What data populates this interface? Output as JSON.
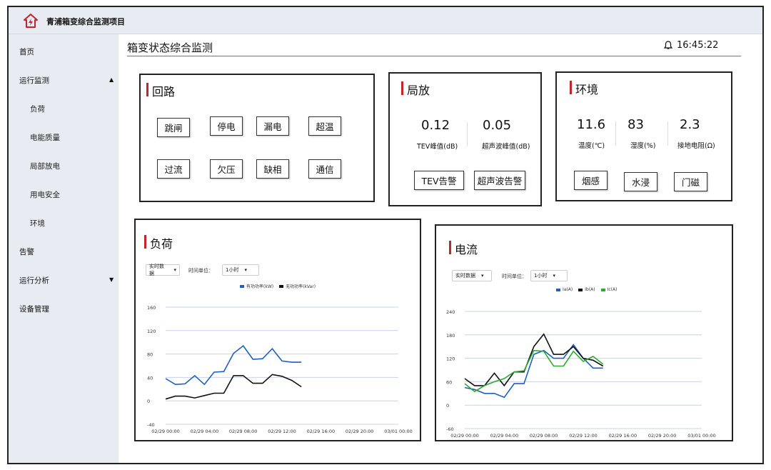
{
  "app": {
    "title": "青浦箱变综合监测项目"
  },
  "sidebar": {
    "items": [
      {
        "label": "首页"
      },
      {
        "label": "运行监测",
        "caret": "▲"
      },
      {
        "label": "负荷"
      },
      {
        "label": "电能质量"
      },
      {
        "label": "局部放电"
      },
      {
        "label": "用电安全"
      },
      {
        "label": "环境"
      },
      {
        "label": "告警"
      },
      {
        "label": "运行分析",
        "caret": "▼"
      },
      {
        "label": "设备管理"
      }
    ]
  },
  "header": {
    "title": "箱变状态综合监测",
    "time": "16:45:22",
    "bell_icon": "bell-icon"
  },
  "circuit": {
    "title": "回路",
    "buttons": [
      "跳闸",
      "停电",
      "漏电",
      "超温",
      "过流",
      "欠压",
      "缺相",
      "通信"
    ]
  },
  "pd": {
    "title": "局放",
    "tev_value": "0.12",
    "tev_label": "TEV峰值(dB)",
    "us_value": "0.05",
    "us_label": "超声波峰值(dB)",
    "buttons": [
      "TEV告警",
      "超声波告警"
    ]
  },
  "env": {
    "title": "环境",
    "temp_value": "11.6",
    "temp_label": "温度(℃)",
    "hum_value": "83",
    "hum_label": "湿度(%)",
    "ground_value": "2.3",
    "ground_label": "接地电阻(Ω)",
    "buttons": [
      "烟感",
      "水浸",
      "门磁"
    ]
  },
  "load_panel": {
    "title": "负荷",
    "dd1": "实时数据",
    "time_unit_label": "时间单位：",
    "dd2": "1小时",
    "legend": [
      "有功功率(kW)",
      "无功功率(kVar)"
    ]
  },
  "current_panel": {
    "title": "电流",
    "dd1": "实时数据",
    "time_unit_label": "时间单位：",
    "dd2": "1小时",
    "legend": [
      "Ia(A)",
      "Ib(A)",
      "Ic(A)"
    ]
  },
  "chart_data": [
    {
      "type": "line",
      "ylim": [
        -40,
        160
      ],
      "yticks": [
        160,
        120,
        80,
        40,
        0,
        -40
      ],
      "xticks": [
        "02/29 00:00",
        "02/29 04:00",
        "02/29 08:00",
        "02/29 12:00",
        "02/29 16:00",
        "02/29 20:00",
        "03/01 00:00"
      ],
      "xmax_hours": 24,
      "series": [
        {
          "name": "有功功率(kW)",
          "color": "#1f5fbf",
          "x": [
            0,
            1,
            2,
            3,
            4,
            5,
            6,
            7,
            8,
            9,
            10,
            11,
            12,
            13,
            14,
            15,
            16
          ],
          "values": [
            38,
            28,
            29,
            43,
            28,
            49,
            50,
            81,
            94,
            71,
            72,
            89,
            68,
            66,
            66,
            null,
            null
          ]
        },
        {
          "name": "无功功率(kVar)",
          "color": "#111111",
          "x": [
            0,
            1,
            2,
            3,
            4,
            5,
            6,
            7,
            8,
            9,
            10,
            11,
            12,
            13,
            14,
            15,
            16
          ],
          "values": [
            3,
            8,
            8,
            5,
            9,
            13,
            13,
            43,
            43,
            30,
            30,
            45,
            42,
            35,
            24,
            null,
            null
          ]
        }
      ]
    },
    {
      "type": "line",
      "ylim": [
        -60,
        240
      ],
      "yticks": [
        240,
        180,
        120,
        60,
        0,
        -60
      ],
      "xticks": [
        "02/29 00:00",
        "02/29 04:00",
        "02/29 08:00",
        "02/29 12:00",
        "02/29 16:00",
        "02/29 20:00",
        "03/01 00:00"
      ],
      "xmax_hours": 24,
      "series": [
        {
          "name": "Ia(A)",
          "color": "#1f5fbf",
          "x": [
            0,
            1,
            2,
            3,
            4,
            5,
            6,
            7,
            8,
            9,
            10,
            11,
            12,
            13,
            14,
            15,
            16
          ],
          "values": [
            45,
            40,
            30,
            30,
            20,
            55,
            55,
            130,
            140,
            120,
            120,
            155,
            120,
            95,
            95,
            null,
            null
          ]
        },
        {
          "name": "Ib(A)",
          "color": "#111111",
          "x": [
            0,
            1,
            2,
            3,
            4,
            5,
            6,
            7,
            8,
            9,
            10,
            11,
            12,
            13,
            14,
            15,
            16
          ],
          "values": [
            68,
            50,
            50,
            82,
            50,
            85,
            85,
            150,
            182,
            130,
            130,
            150,
            120,
            115,
            100,
            null,
            null
          ]
        },
        {
          "name": "Ic(A)",
          "color": "#2eaa2e",
          "x": [
            0,
            1,
            2,
            3,
            4,
            5,
            6,
            7,
            8,
            9,
            10,
            11,
            12,
            13,
            14,
            15,
            16
          ],
          "values": [
            55,
            35,
            50,
            60,
            68,
            85,
            88,
            140,
            138,
            100,
            100,
            138,
            112,
            125,
            105,
            null,
            null
          ]
        }
      ]
    }
  ]
}
